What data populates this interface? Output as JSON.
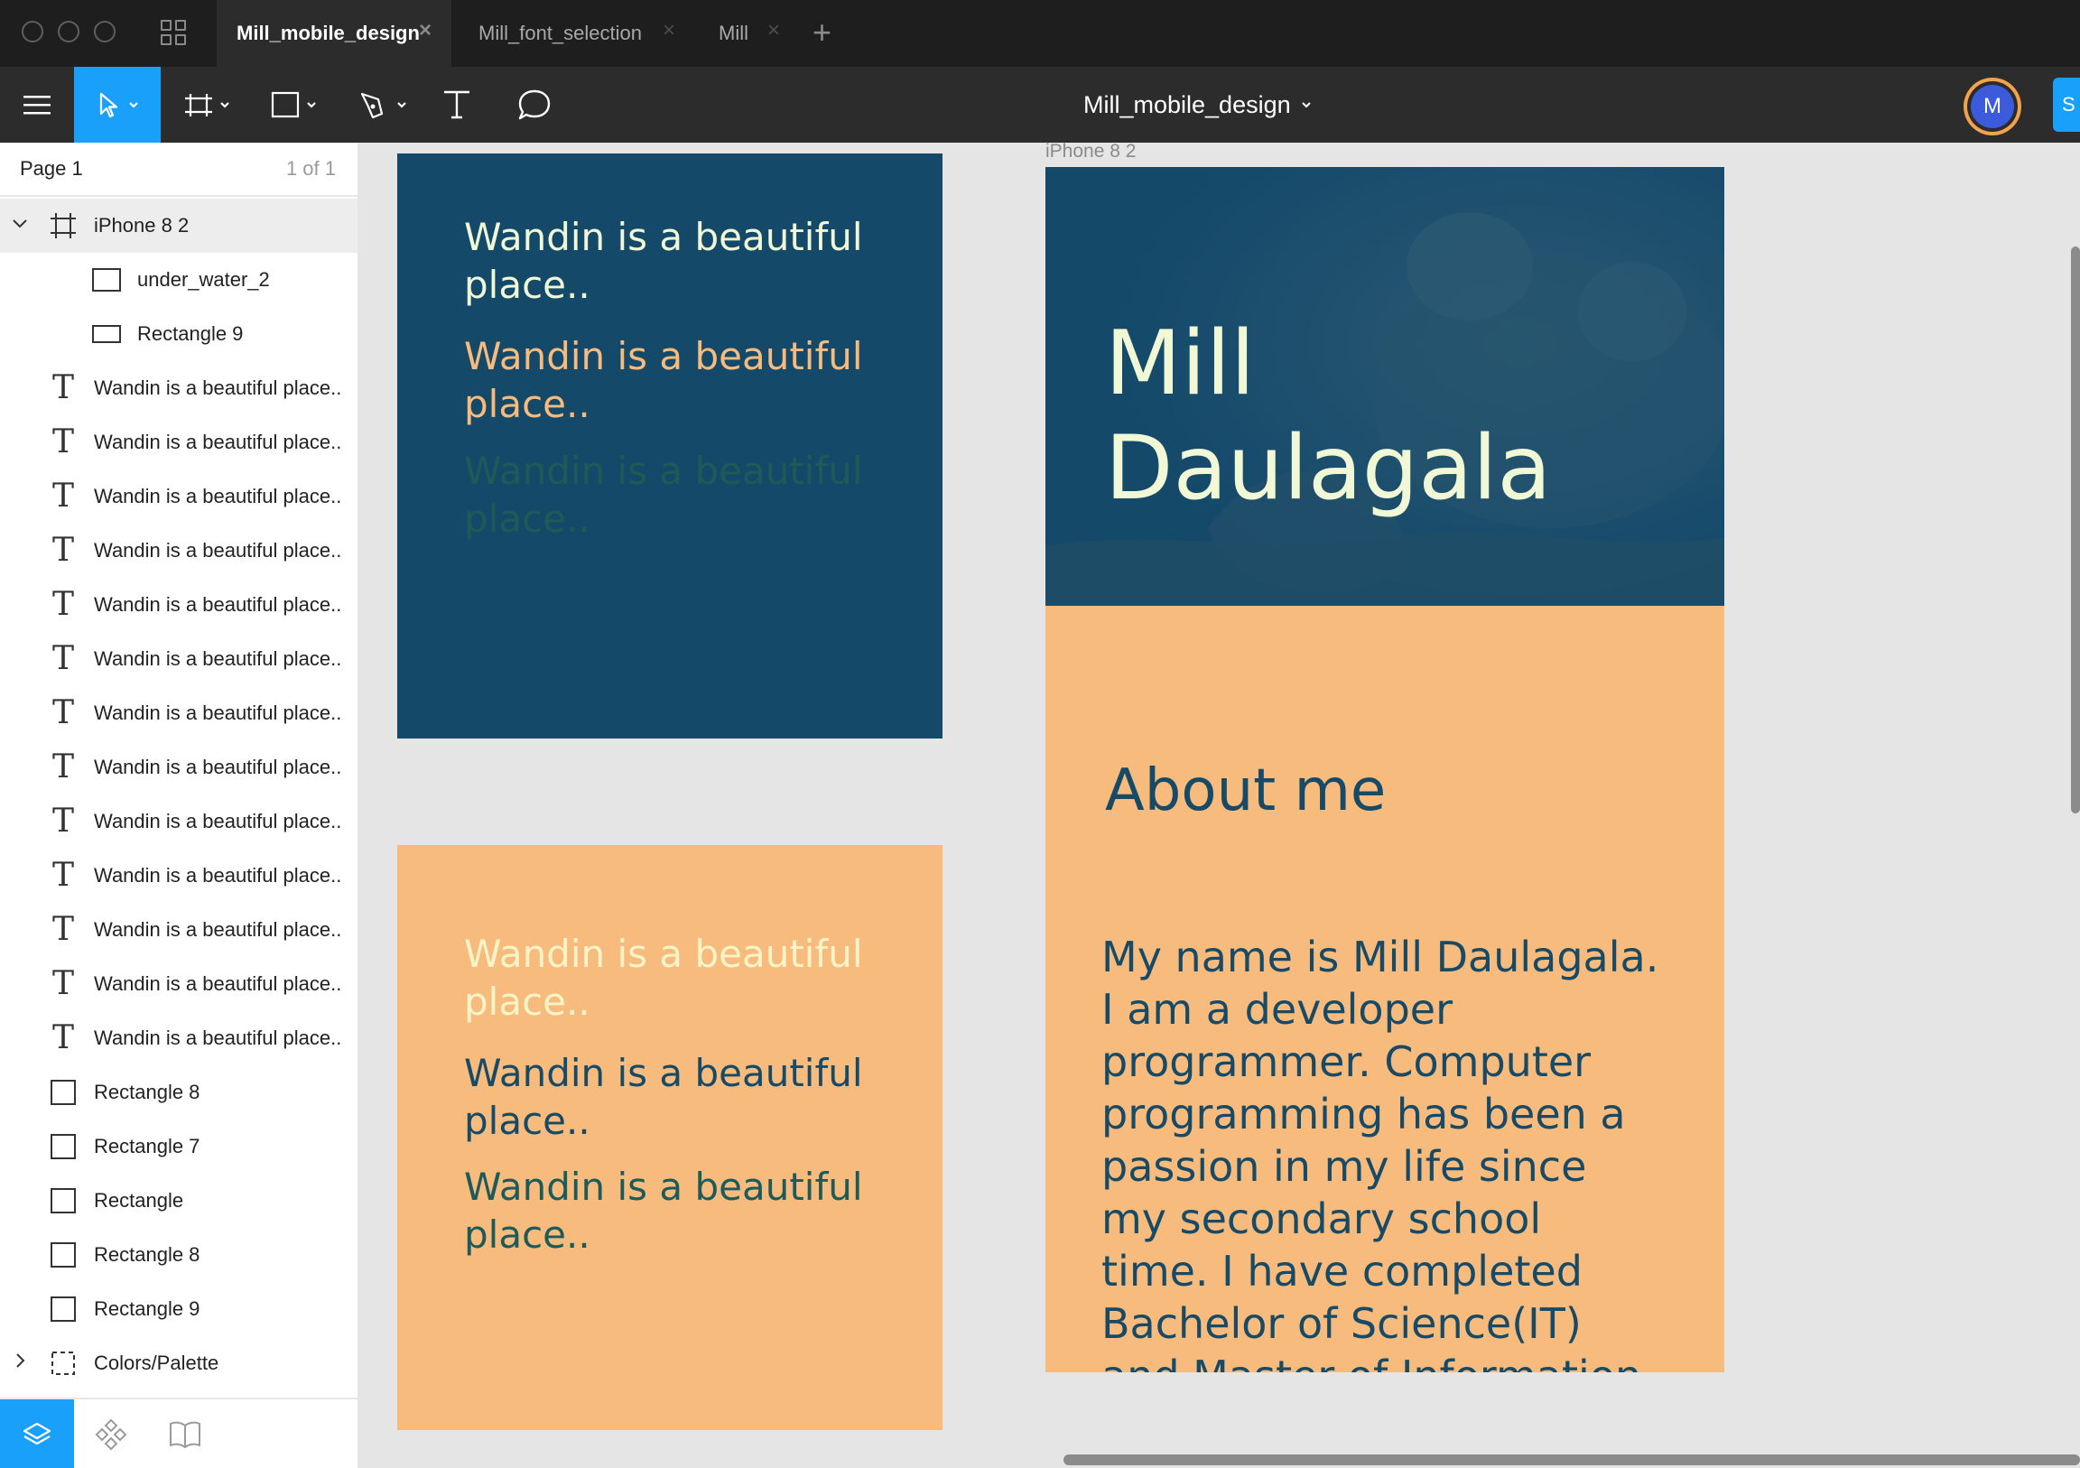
{
  "tabs": [
    {
      "label": "Mill_mobile_design",
      "active": true
    },
    {
      "label": "Mill_font_selection",
      "active": false
    },
    {
      "label": "Mill",
      "active": false
    }
  ],
  "toolbar": {
    "document_title": "Mill_mobile_design",
    "avatar_initial": "M",
    "share_label": "S"
  },
  "layers_panel": {
    "page_name": "Page 1",
    "page_count": "1 of 1",
    "layers": [
      {
        "label": "iPhone 8 2",
        "icon": "frame-icon"
      },
      {
        "label": "under_water_2",
        "icon": "image-rect-icon"
      },
      {
        "label": "Rectangle 9",
        "icon": "rectangle-icon"
      },
      {
        "label": "Wandin is a beautiful place..",
        "icon": "text-icon"
      },
      {
        "label": "Wandin is a beautiful place..",
        "icon": "text-icon"
      },
      {
        "label": "Wandin is a beautiful place..",
        "icon": "text-icon"
      },
      {
        "label": "Wandin is a beautiful place..",
        "icon": "text-icon"
      },
      {
        "label": "Wandin is a beautiful place..",
        "icon": "text-icon"
      },
      {
        "label": "Wandin is a beautiful place..",
        "icon": "text-icon"
      },
      {
        "label": "Wandin is a beautiful place..",
        "icon": "text-icon"
      },
      {
        "label": "Wandin is a beautiful place..",
        "icon": "text-icon"
      },
      {
        "label": "Wandin is a beautiful place..",
        "icon": "text-icon"
      },
      {
        "label": "Wandin is a beautiful place..",
        "icon": "text-icon"
      },
      {
        "label": "Wandin is a beautiful place..",
        "icon": "text-icon"
      },
      {
        "label": "Wandin is a beautiful place..",
        "icon": "text-icon"
      },
      {
        "label": "Wandin is a beautiful place..",
        "icon": "text-icon"
      },
      {
        "label": "Rectangle 8",
        "icon": "rectangle-icon"
      },
      {
        "label": "Rectangle 7",
        "icon": "rectangle-icon"
      },
      {
        "label": "Rectangle",
        "icon": "rectangle-icon"
      },
      {
        "label": "Rectangle 8",
        "icon": "rectangle-icon"
      },
      {
        "label": "Rectangle 9",
        "icon": "rectangle-icon"
      },
      {
        "label": "Colors/Palette",
        "icon": "group-icon"
      }
    ]
  },
  "canvas": {
    "dark_card": {
      "background": "#14496a",
      "lines": [
        {
          "text": "Wandin is a beautiful place..",
          "color": "#f1f8d6"
        },
        {
          "text": "Wandin is a beautiful place..",
          "color": "#f6bb7d"
        },
        {
          "text": "Wandin is a beautiful place..",
          "color": "#1f5a56"
        }
      ]
    },
    "light_card": {
      "background": "#f6bb7d",
      "lines": [
        {
          "text": "Wandin is a beautiful place..",
          "color": "#f8f4c8"
        },
        {
          "text": "Wandin is a beautiful place..",
          "color": "#164a66"
        },
        {
          "text": "Wandin is a beautiful place..",
          "color": "#1d5a5a"
        }
      ]
    },
    "frame_label": "iPhone 8 2",
    "iphone": {
      "hero_title_line1": "Mill",
      "hero_title_line2": "Daulagala",
      "about_title": "About me",
      "about_text": "My name is Mill Daulagala. I am a developer programmer. Computer programming has been a passion in my life since my secondary school time. I have completed Bachelor of Science(IT) and Master of Information"
    }
  },
  "colors": {
    "accent": "#18a0fb",
    "navy": "#14496a",
    "peach": "#f6bb7d",
    "cream": "#f1f8d6"
  }
}
